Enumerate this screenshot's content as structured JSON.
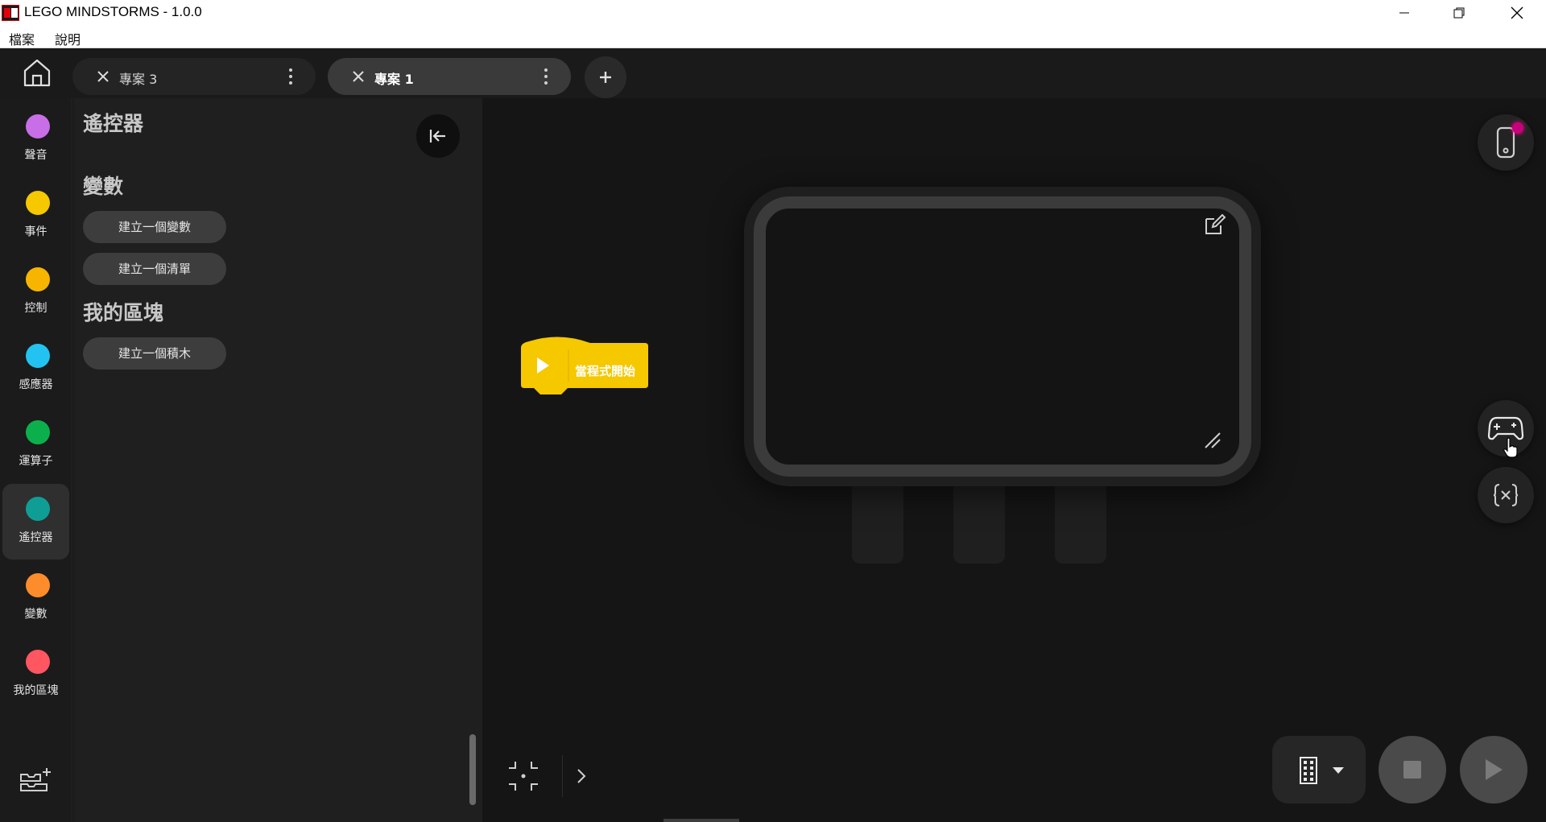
{
  "window": {
    "title": "LEGO MINDSTORMS - 1.0.0",
    "logo_icon": "lego-mindstorms-logo",
    "controls": [
      "minimize-icon",
      "restore-icon",
      "close-icon"
    ]
  },
  "menu": {
    "file": "檔案",
    "help": "說明"
  },
  "tabs": [
    {
      "label": "專案 3",
      "active": false
    },
    {
      "label": "專案 1",
      "active": true
    }
  ],
  "add_tab_icon": "plus-icon",
  "categories": [
    {
      "label": "聲音",
      "color": "#c86ee6"
    },
    {
      "label": "事件",
      "color": "#f5c800"
    },
    {
      "label": "控制",
      "color": "#f7b500"
    },
    {
      "label": "感應器",
      "color": "#22c3f0"
    },
    {
      "label": "運算子",
      "color": "#0bb04c"
    },
    {
      "label": "遙控器",
      "color": "#0f9e96",
      "active": true
    },
    {
      "label": "變數",
      "color": "#ff8c2b"
    },
    {
      "label": "我的區塊",
      "color": "#ff5661"
    }
  ],
  "palette": {
    "section_remote": "遙控器",
    "section_variables": "變數",
    "make_variable": "建立一個變數",
    "make_list": "建立一個清單",
    "section_my_blocks": "我的區塊",
    "make_block": "建立一個積木"
  },
  "canvas": {
    "hat_block_label": "當程式開始",
    "hat_block_color": "#f5c800"
  },
  "toolbar": {
    "hub_status_color": "#c8007a",
    "hub_icon": "hub-connection-icon",
    "remote_icon": "gamepad-icon",
    "variables_icon": "variable-x-icon",
    "stop_icon": "stop-icon",
    "play_icon": "play-icon"
  }
}
